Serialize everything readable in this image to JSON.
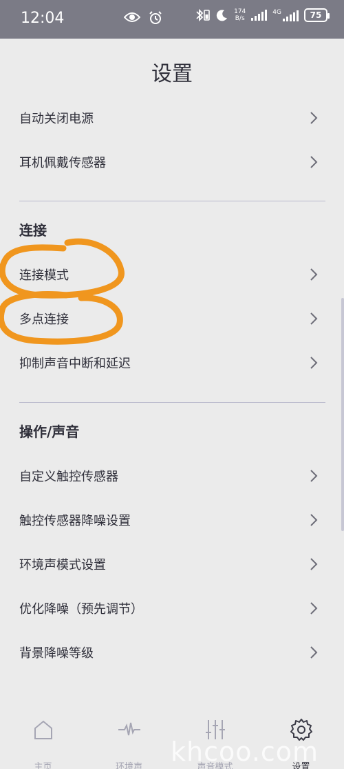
{
  "status_bar": {
    "time": "12:04",
    "net_speed": "174",
    "net_unit": "B/s",
    "network_type": "4G",
    "battery": "75"
  },
  "page": {
    "title": "设置"
  },
  "rows_top": [
    {
      "label": "自动关闭电源"
    },
    {
      "label": "耳机佩戴传感器"
    }
  ],
  "section_connect": {
    "header": "连接",
    "items": [
      {
        "label": "连接模式"
      },
      {
        "label": "多点连接"
      },
      {
        "label": "抑制声音中断和延迟"
      }
    ]
  },
  "section_ops": {
    "header": "操作/声音",
    "items": [
      {
        "label": "自定义触控传感器"
      },
      {
        "label": "触控传感器降噪设置"
      },
      {
        "label": "环境声模式设置"
      },
      {
        "label": "优化降噪（预先调节）"
      },
      {
        "label": "背景降噪等级"
      }
    ]
  },
  "bottom_nav": {
    "items": [
      {
        "label": "主页",
        "icon": "home-icon"
      },
      {
        "label": "环境声",
        "icon": "waveform-icon"
      },
      {
        "label": "声音模式",
        "icon": "equalizer-icon"
      },
      {
        "label": "设置",
        "icon": "gear-icon",
        "active": true
      }
    ]
  },
  "watermark": "khcoo.com",
  "colors": {
    "background": "#ebebeb",
    "status_bar": "#7b7b86",
    "text": "#2f2f3a",
    "annotation": "#f0961e",
    "inactive_nav": "#a5a5b3"
  }
}
